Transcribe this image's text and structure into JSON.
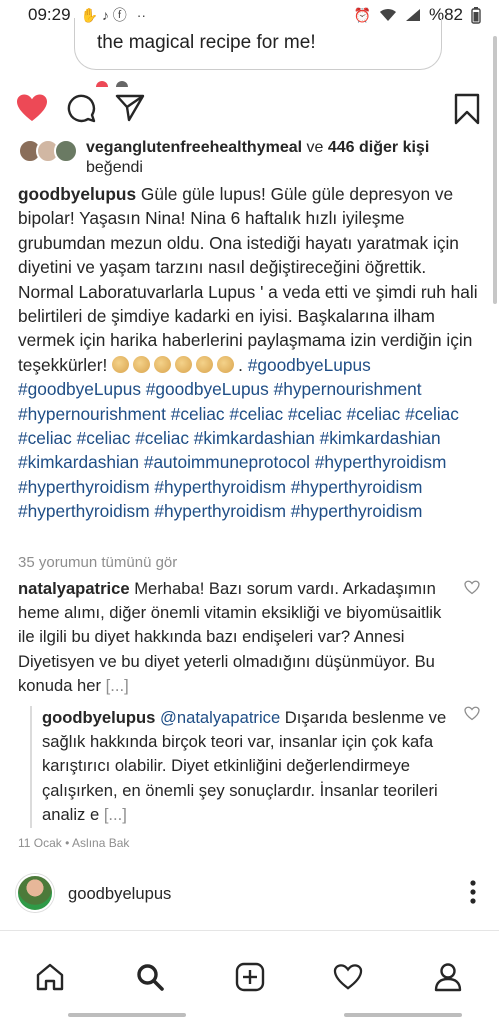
{
  "status_bar": {
    "time": "09:29",
    "battery": "%82",
    "more_dots": "··"
  },
  "bubble": {
    "text": "the magical recipe for me!"
  },
  "likes": {
    "first_user": "veganglutenfreehealthymeal",
    "connector": " ve ",
    "others": "446 diğer kişi",
    "suffix": "beğendi"
  },
  "caption": {
    "username": "goodbyelupus",
    "text": " Güle güle lupus! Güle güle depresyon ve bipolar! Yaşasın Nina! Nina 6 haftalık hızlı iyileşme grubumdan mezun oldu. Ona istediği hayatı yaratmak için diyetini ve yaşam tarzını nasıl değiştireceğini öğrettik. Normal Laboratuvarlarla Lupus ' a veda etti ve şimdi ruh hali belirtileri de şimdiye kadarki en iyisi. Başkalarına ilham vermek için harika haberlerini paylaşmama izin verdiğin için teşekkürler! ",
    "after_claps": ". ",
    "hashtags": "#goodbyeLupus #goodbyeLupus #goodbyeLupus #hypernourishment #hypernourishment #celiac #celiac #celiac #celiac #celiac #celiac #celiac #celiac #kimkardashian #kimkardashian #kimkardashian #autoimmuneprotocol #hyperthyroidism #hyperthyroidism #hyperthyroidism #hyperthyroidism #hyperthyroidism #hyperthyroidism #hyperthyroidism"
  },
  "view_all_comments": "35 yorumun tümünü gör",
  "comments": [
    {
      "username": "natalyapatrice",
      "text": " Merhaba! Bazı sorum vardı. Arkadaşımın heme alımı, diğer önemli vitamin eksikliği ve biyomüsaitlik ile ilgili bu diyet hakkında bazı endişeleri var? Annesi Diyetisyen ve bu diyet yeterli olmadığını düşünmüyor. Bu konuda her ",
      "more": "[...]"
    },
    {
      "username": "goodbyelupus",
      "mention": "@natalyapatrice",
      "text": " Dışarıda beslenme ve sağlık hakkında birçok teori var, insanlar için çok kafa karıştırıcı olabilir. Diyet etkinliğini değerlendirmeye çalışırken, en önemli şey sonuçlardır. İnsanlar teorileri analiz e ",
      "more": "[...]"
    }
  ],
  "comment_meta": {
    "date": "11 Ocak",
    "separator": " • ",
    "translate": "Aslına Bak"
  },
  "comment_input": {
    "username": "goodbyelupus"
  },
  "colors": {
    "like_red": "#ed4956",
    "hashtag_blue": "#1f4e86",
    "muted": "#8e8e8e"
  },
  "icons": {
    "actions": [
      "heart-filled-icon",
      "comment-icon",
      "share-icon",
      "bookmark-icon"
    ],
    "tabs": [
      "home-icon",
      "search-icon",
      "add-post-icon",
      "activity-heart-icon",
      "profile-icon"
    ]
  }
}
